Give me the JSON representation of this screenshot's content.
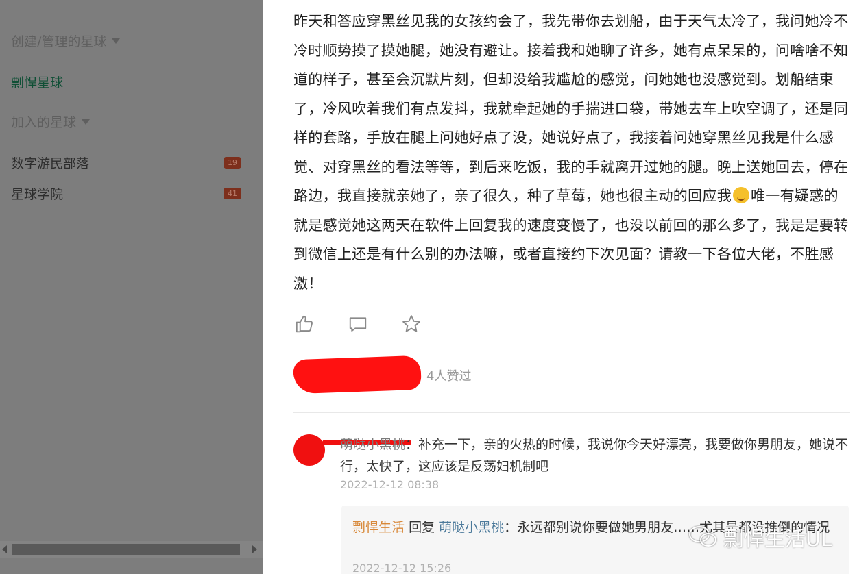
{
  "sidebar": {
    "section_created": "创建/管理的星球",
    "active_planet": "剽悍星球",
    "section_joined": "加入的星球",
    "items": [
      {
        "label": "数字游民部落",
        "badge": "19"
      },
      {
        "label": "星球学院",
        "badge": "41"
      }
    ]
  },
  "post": {
    "text_before_emoji": "昨天和答应穿黑丝见我的女孩约会了，我先带你去划船，由于天气太冷了，我问她冷不冷时顺势摸了摸她腿，她没有避让。接着我和她聊了许多，她有点呆呆的，问啥啥不知道的样子，甚至会沉默片刻，但却没给我尴尬的感觉，问她她也没感觉到。划船结束了，冷风吹着我们有点发抖，我就牵起她的手揣进口袋，带她去车上吹空调了，还是同样的套路，手放在腿上问她好点了没，她说好点了，我接着问她穿黑丝见我是什么感觉、对穿黑丝的看法等等，到后来吃饭，我的手就离开过她的腿。晚上送她回去，停在路边，我直接就亲她了，亲了很久，种了草莓，她也很主动的回应我",
    "text_after_emoji": "唯一有疑惑的就是感觉她这两天在软件上回复我的速度变慢了，也没以前回的那么多了，我是是要转到微信上还是有什么别的办法嘛，或者直接约下次见面？请教一下各位大佬，不胜感激！",
    "likes_text": "4人赞过"
  },
  "comment": {
    "author": "萌哒小黑桃",
    "text": "补充一下，亲的火热的时候，我说你今天好漂亮，我要做你男朋友，她说不行，太快了，这应该是反荡妇机制吧",
    "time": "2022-12-12 08:38"
  },
  "reply": {
    "user": "剽悍生活",
    "verb": "回复",
    "target": "萌哒小黑桃",
    "text": "永远都别说你要做她男朋友……尤其是都没推倒的情况",
    "time": "2022-12-12 15:26"
  },
  "watermark": {
    "text": "剽悍生活UL"
  },
  "colors": {
    "active": "#0f4f35",
    "badge": "#7d2f1c",
    "reply_user": "#d8893a",
    "reply_target": "#4c7a9b"
  },
  "icons": [
    "like-icon",
    "comment-icon",
    "star-icon",
    "wechat-icon",
    "smile-emoji"
  ]
}
